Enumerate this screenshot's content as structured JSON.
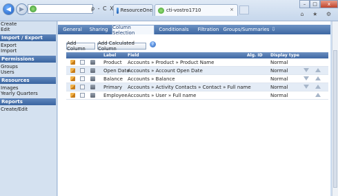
{
  "browser": {
    "address_controls": "ρ - C X",
    "tabs": [
      {
        "label": "ResourceOne",
        "active": false
      },
      {
        "label": "cti-vostro1710",
        "active": true,
        "close": "×"
      }
    ],
    "window_buttons": [
      "–",
      "□",
      "x"
    ],
    "right_icons": "⌂ ★ ⚙"
  },
  "sidebar": {
    "top_links": [
      "Create",
      "Edit"
    ],
    "sections": [
      {
        "title": "Import / Export",
        "items": [
          "Export",
          "Import"
        ]
      },
      {
        "title": "Permissions",
        "items": [
          "Groups",
          "Users"
        ]
      },
      {
        "title": "Resources",
        "items": [
          "Images",
          "Yearly Quarters"
        ]
      },
      {
        "title": "Reports",
        "items": [
          "Create/Edit"
        ]
      }
    ]
  },
  "main": {
    "tabs": [
      "General",
      "Sharing",
      "Column Selection",
      "Conditionals",
      "Filtration",
      "Groups/Summaries"
    ],
    "active_tab": "Column Selection",
    "add_column_label": "Add Column",
    "add_calculated_label": "Add Calculated Column",
    "grid": {
      "headers": {
        "label": "Label",
        "field": "Field",
        "agg": "Alg. ID",
        "display": "Display type"
      },
      "rows": [
        {
          "label": "Product",
          "field": "Accounts » Product » Product Name",
          "display": "Normal",
          "down": false,
          "up": false
        },
        {
          "label": "Open Date",
          "field": "Accounts » Account Open Date",
          "display": "Normal",
          "down": true,
          "up": true
        },
        {
          "label": "Balance",
          "field": "Accounts » Balance",
          "display": "Normal",
          "down": true,
          "up": true
        },
        {
          "label": "Primary",
          "field": "Accounts » Activity Contacts » Contact » Full name",
          "display": "Normal",
          "down": true,
          "up": true
        },
        {
          "label": "Employee",
          "field": "Accounts » User » Full name",
          "display": "Normal",
          "down": false,
          "up": true
        }
      ]
    }
  },
  "colors": {
    "header_blue": "#3f68a3",
    "row_alt": "#e4ecf6",
    "sidebar_bg": "#d4e1f0"
  }
}
